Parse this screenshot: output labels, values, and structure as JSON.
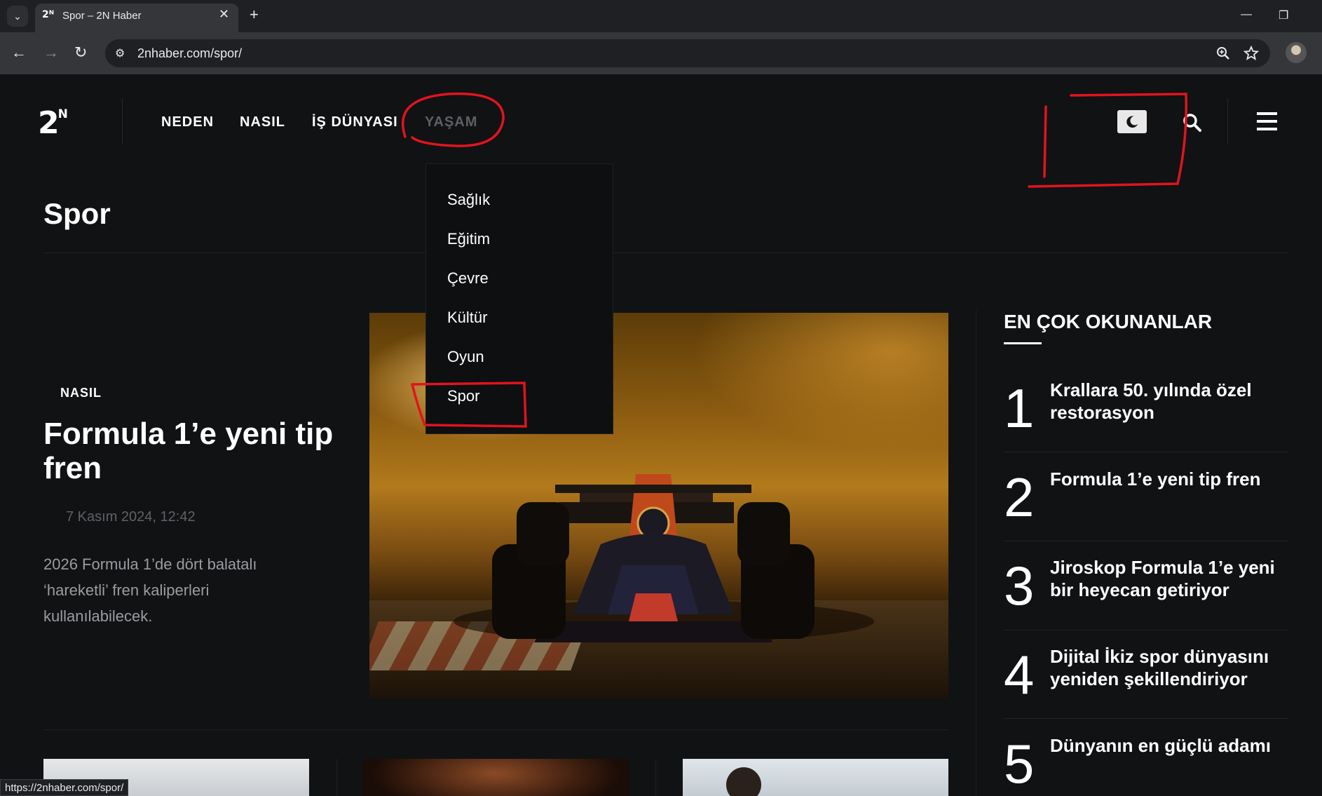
{
  "browser": {
    "tab_title": "Spor – 2N Haber",
    "tab_favicon": "2ᴺ",
    "url": "2nhaber.com/spor/",
    "status_url": "https://2nhaber.com/spor/"
  },
  "site": {
    "logo": "2",
    "logo_sup": "N",
    "nav": [
      "NEDEN",
      "NASIL",
      "İŞ DÜNYASI",
      "YAŞAM"
    ],
    "dropdown": [
      "Sağlık",
      "Eğitim",
      "Çevre",
      "Kültür",
      "Oyun",
      "Spor"
    ]
  },
  "page": {
    "title": "Spor"
  },
  "featured": {
    "category": "NASIL",
    "title": "Formula 1’e yeni tip fren",
    "date": "7 Kasım 2024,  12:42",
    "excerpt": "2026 Formula 1’de dört balatalı ‘hareketli’ fren kaliperleri kullanılabilecek."
  },
  "most_read": {
    "heading": "EN ÇOK OKUNANLAR",
    "items": [
      {
        "num": "1",
        "title": "Krallara 50. yılında özel restorasyon"
      },
      {
        "num": "2",
        "title": "Formula 1’e yeni tip fren"
      },
      {
        "num": "3",
        "title": "Jiroskop Formula 1’e yeni bir heyecan getiriyor"
      },
      {
        "num": "4",
        "title": "Dijital İkiz spor dünyasını yeniden şekillendiriyor"
      },
      {
        "num": "5",
        "title": "Dünyanın en güçlü adamı"
      }
    ]
  },
  "colors": {
    "page_bg": "#111214",
    "nav_active_dim": "#5d5f63",
    "annotation_red": "#e0141e"
  }
}
